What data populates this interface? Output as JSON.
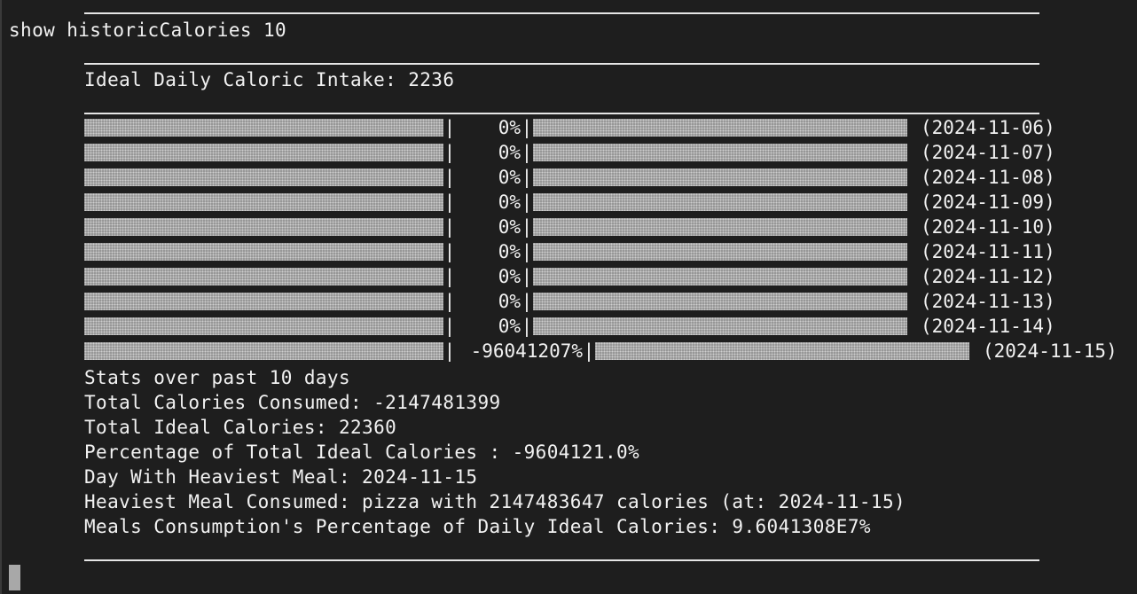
{
  "command": "show historicCalories 10",
  "ideal_intake": "Ideal Daily Caloric Intake: 2236",
  "rows": [
    {
      "pct": "0%",
      "date": "(2024-11-06)"
    },
    {
      "pct": "0%",
      "date": "(2024-11-07)"
    },
    {
      "pct": "0%",
      "date": "(2024-11-08)"
    },
    {
      "pct": "0%",
      "date": "(2024-11-09)"
    },
    {
      "pct": "0%",
      "date": "(2024-11-10)"
    },
    {
      "pct": "0%",
      "date": "(2024-11-11)"
    },
    {
      "pct": "0%",
      "date": "(2024-11-12)"
    },
    {
      "pct": "0%",
      "date": "(2024-11-13)"
    },
    {
      "pct": "0%",
      "date": "(2024-11-14)"
    },
    {
      "pct": "-96041207%",
      "date": "(2024-11-15)"
    }
  ],
  "stats": {
    "header": "Stats over past 10 days",
    "total_consumed": "Total Calories Consumed: -2147481399",
    "total_ideal": "Total Ideal Calories: 22360",
    "percentage": "Percentage of Total Ideal Calories : -9604121.0%",
    "heaviest_day": "Day With Heaviest Meal: 2024-11-15",
    "heaviest_meal": "Heaviest Meal Consumed: pizza with 2147483647 calories (at: 2024-11-15)",
    "meals_percentage": "Meals Consumption's Percentage of Daily Ideal Calories: 9.6041308E7%"
  }
}
